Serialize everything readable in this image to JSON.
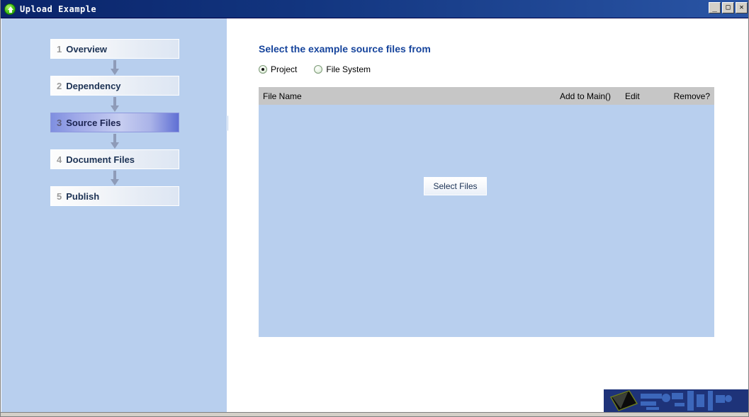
{
  "window": {
    "title": "Upload Example",
    "icon": "upload-circle-icon",
    "buttons": {
      "minimize": "_",
      "maximize": "□",
      "close": "✕"
    }
  },
  "sidebar": {
    "steps": [
      {
        "number": "1",
        "label": "Overview",
        "active": false
      },
      {
        "number": "2",
        "label": "Dependency",
        "active": false
      },
      {
        "number": "3",
        "label": "Source Files",
        "active": true
      },
      {
        "number": "4",
        "label": "Document Files",
        "active": false
      },
      {
        "number": "5",
        "label": "Publish",
        "active": false
      }
    ],
    "connector_icon": "down-arrow-icon"
  },
  "main": {
    "heading": "Select the example source files from",
    "source_options": [
      {
        "label": "Project",
        "selected": true
      },
      {
        "label": "File System",
        "selected": false
      }
    ],
    "table": {
      "columns": {
        "file_name": "File Name",
        "add_to_main": "Add to Main()",
        "edit": "Edit",
        "remove": "Remove?"
      },
      "rows": []
    },
    "select_files_label": "Select Files"
  },
  "colors": {
    "titlebar_start": "#0a246a",
    "titlebar_end": "#2a55a5",
    "sidebar_bg": "#b8cfee",
    "active_step": "#7f8fe0",
    "heading_blue": "#16449c",
    "table_header_gray": "#c6c6c6",
    "table_body_blue": "#b8cfee",
    "brand_navy": "#1e3379"
  }
}
